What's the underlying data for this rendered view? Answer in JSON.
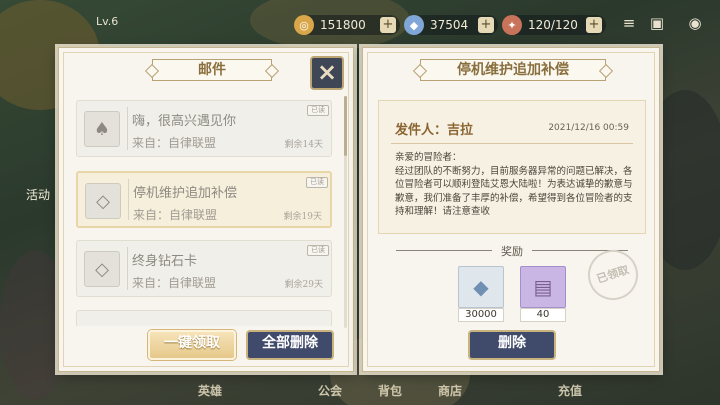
{
  "hud": {
    "level": "Lv.6",
    "gold": "151800",
    "gems": "37504",
    "stamina": "120/120"
  },
  "side": {
    "event_label": "活动"
  },
  "bottom_nav": [
    "英雄",
    "",
    "公会",
    "背包",
    "商店",
    "",
    "充值"
  ],
  "mail_panel": {
    "title": "邮件",
    "close_label": "×",
    "items": [
      {
        "title": "嗨，很高兴遇见你",
        "from": "来自：自律联盟",
        "remaining": "剩余14天",
        "badge": "已读",
        "icon": "avatar-icon"
      },
      {
        "title": "停机维护追加补偿",
        "from": "来自：自律联盟",
        "remaining": "剩余19天",
        "badge": "已读",
        "icon": "gem-icon"
      },
      {
        "title": "终身钻石卡",
        "from": "来自：自律联盟",
        "remaining": "剩余29天",
        "badge": "已读",
        "icon": "gem-icon"
      }
    ],
    "claim_all_label": "一键领取",
    "delete_all_label": "全部删除"
  },
  "detail": {
    "title": "停机维护追加补偿",
    "sender": "发件人：吉拉",
    "date": "2021/12/16 00:59",
    "greeting": "亲爱的冒险者：",
    "body": "经过团队的不断努力，目前服务器异常的问题已解决，各位冒险者可以顺利登陆艾恩大陆啦！为表达诚挚的歉意与歉意，我们准备了丰厚的补偿，希望得到各位冒险者的支持和理解！请注意查收",
    "rewards_label": "奖励",
    "rewards": [
      {
        "icon": "diamond-icon",
        "qty": "30000"
      },
      {
        "icon": "card-icon",
        "qty": "40"
      }
    ],
    "claimed_stamp": "已领取",
    "delete_label": "删除"
  },
  "colors": {
    "navy_button": "#404a6b",
    "gold_button": "#e6c88b",
    "accent_text": "#8a6431"
  }
}
